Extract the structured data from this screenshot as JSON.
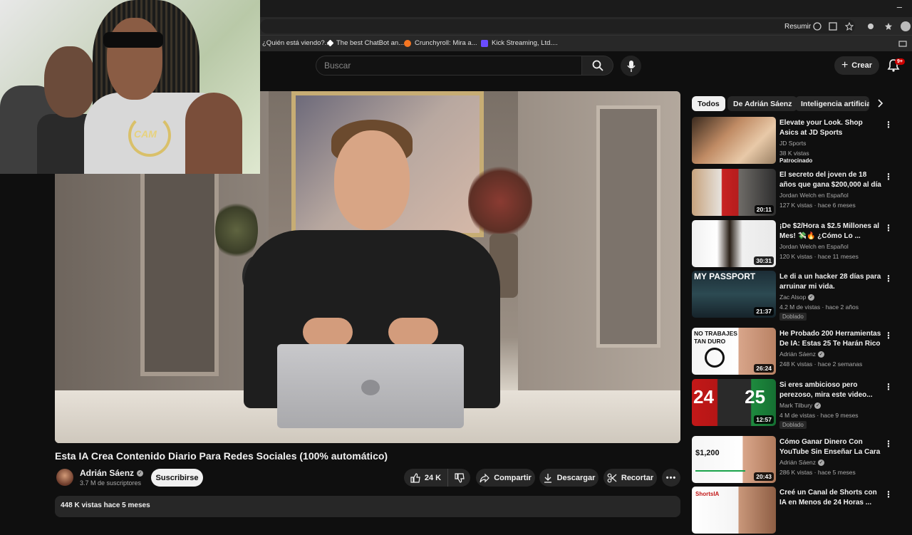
{
  "browser": {
    "toolbar_label": "Resumir",
    "bookmarks": [
      {
        "label": "¿Quién está viendo?...",
        "color": "#e0e0e0"
      },
      {
        "label": "The best ChatBot an...",
        "color": "#ffffff"
      },
      {
        "label": "Crunchyroll: Mira a...",
        "color": "#f47521"
      },
      {
        "label": "Kick Streaming, Ltd....",
        "color": "#6a4cff"
      }
    ]
  },
  "header": {
    "search_placeholder": "Buscar",
    "create_label": "Crear",
    "notifications": "9+"
  },
  "video": {
    "title": "Esta IA Crea Contenido Diario Para Redes Sociales (100% automático)",
    "channel": "Adrián Sáenz",
    "subscribers": "3.7 M de suscriptores",
    "subscribe_label": "Suscribirse",
    "likes": "24 K",
    "share_label": "Compartir",
    "download_label": "Descargar",
    "clip_label": "Recortar",
    "stats": "448 K vistas  hace 5 meses",
    "pip_text": "CAM"
  },
  "chips": [
    "Todos",
    "De Adrián Sáenz",
    "Inteligencia artificia"
  ],
  "recommendations": [
    {
      "title": "Elevate your Look. Shop Asics at JD Sports",
      "channel": "JD Sports",
      "meta": "38 K vistas",
      "badge": "Patrocinado",
      "duration": ""
    },
    {
      "title": "El secreto del joven de 18 años que gana $200,000 al día",
      "channel": "Jordan Welch en Español",
      "meta": "127 K vistas · hace 6 meses",
      "badge": "",
      "duration": "20:11"
    },
    {
      "title": "¡De $2/Hora a $2.5 Millones al Mes! 💸🔥 ¿Cómo Lo ...",
      "channel": "Jordan Welch en Español",
      "meta": "120 K vistas · hace 11 meses",
      "badge": "",
      "duration": "30:31"
    },
    {
      "title": "Le di a un hacker 28 días para arruinar mi vida.",
      "channel": "Zac Alsop",
      "meta": "4.2 M de vistas · hace 2 años",
      "badge": "Doblado",
      "duration": "21:37",
      "thumb_text": "MY PASSPORT"
    },
    {
      "title": "He Probado 200 Herramientas De IA: Estas 25 Te Harán Rico",
      "channel": "Adrián Sáenz",
      "meta": "248 K vistas · hace 2 semanas",
      "badge": "",
      "duration": "26:24",
      "thumb_text": "NO TRABAJES TAN DURO"
    },
    {
      "title": "Si eres ambicioso pero perezoso, mira este video...",
      "channel": "Mark Tilbury",
      "meta": "4 M de vistas · hace 9 meses",
      "badge": "Doblado",
      "duration": "12:57",
      "thumb_text": "24 25"
    },
    {
      "title": "Cómo Ganar Dinero Con YouTube Sin Enseñar La Cara",
      "channel": "Adrián Sáenz",
      "meta": "286 K vistas · hace 5 meses",
      "badge": "",
      "duration": "20:43",
      "thumb_text": "$1,200"
    },
    {
      "title": "Creé un Canal de Shorts con IA en Menos de 24 Horas ...",
      "channel": "",
      "meta": "",
      "badge": "",
      "duration": "",
      "thumb_text": "ShortsIA"
    }
  ]
}
